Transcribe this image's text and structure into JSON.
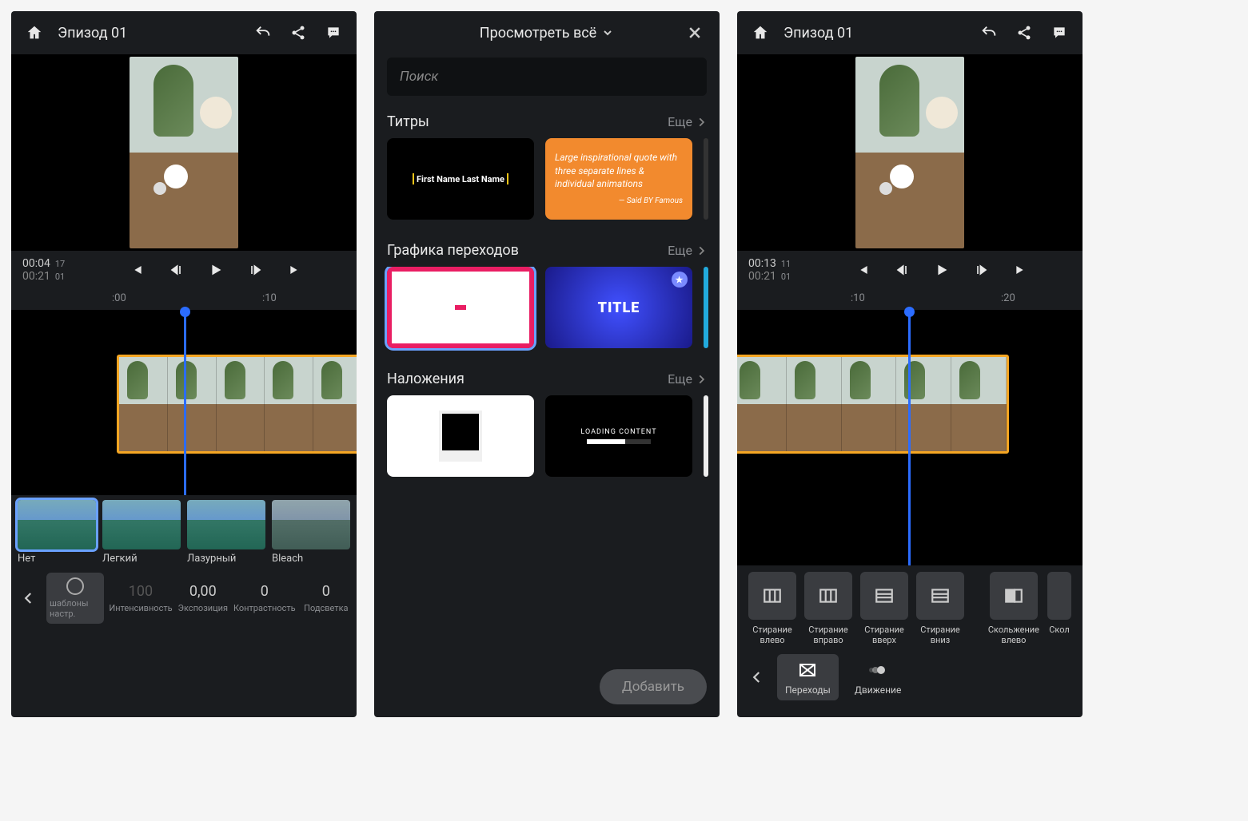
{
  "p1": {
    "title": "Эпизод 01",
    "tc_current": "00:04",
    "tc_cur_f": "17",
    "tc_total": "00:21",
    "tc_tot_f": "01",
    "ruler": [
      ":00",
      ":10"
    ],
    "filters": [
      {
        "name": "Нет",
        "sel": true
      },
      {
        "name": "Легкий"
      },
      {
        "name": "Лазурный"
      },
      {
        "name": "Bleach"
      }
    ],
    "adj": {
      "presets_label": "шаблоны настр.",
      "items": [
        {
          "val": "100",
          "lbl": "Интенсивность",
          "dim": true
        },
        {
          "val": "0,00",
          "lbl": "Экспозиция"
        },
        {
          "val": "0",
          "lbl": "Контрастность"
        },
        {
          "val": "0",
          "lbl": "Подсветка"
        }
      ]
    }
  },
  "p2": {
    "title": "Просмотреть всё",
    "search_ph": "Поиск",
    "more": "Еще",
    "sections": {
      "titles": "Титры",
      "trans": "Графика переходов",
      "overlays": "Наложения"
    },
    "card_name": "First Name Last Name",
    "card_quote": "Large inspirational quote with three separate lines & individual animations",
    "card_quote_by": "— Said BY Famous",
    "card_title": "TITLE",
    "card_loading": "LOADING CONTENT",
    "add": "Добавить"
  },
  "p3": {
    "title": "Эпизод 01",
    "tc_current": "00:13",
    "tc_cur_f": "11",
    "tc_total": "00:21",
    "tc_tot_f": "01",
    "ruler": [
      ":10",
      ":20"
    ],
    "transitions": [
      "Стирание влево",
      "Стирание вправо",
      "Стирание вверх",
      "Стирание вниз",
      "Скольжение влево",
      "Скол"
    ],
    "modes": {
      "transitions": "Переходы",
      "motion": "Движение"
    }
  }
}
